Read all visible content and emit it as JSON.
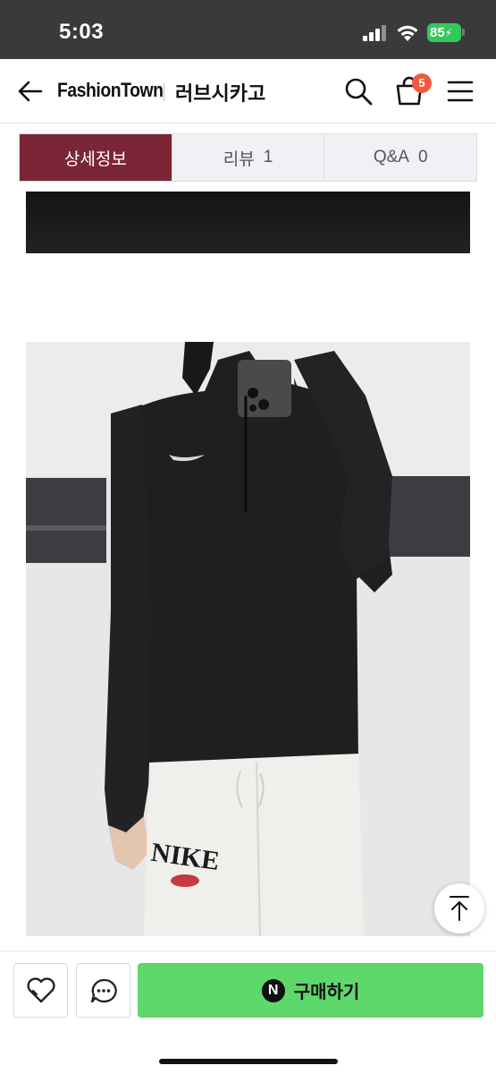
{
  "status_bar": {
    "time": "5:03",
    "battery": "85"
  },
  "header": {
    "brand": "FashionTown",
    "shop_name": "러브시카고",
    "cart_count": "5"
  },
  "tabs": [
    {
      "label": "상세정보",
      "count": "",
      "active": true
    },
    {
      "label": "리뷰",
      "count": "1",
      "active": false
    },
    {
      "label": "Q&A",
      "count": "0",
      "active": false
    }
  ],
  "product_image": {
    "print_text": "NIKE"
  },
  "bottom_bar": {
    "buy_label": "구매하기",
    "pay_badge": "N"
  },
  "colors": {
    "accent_tab": "#7a2636",
    "buy_green": "#5ed76b",
    "badge": "#ef5a3a"
  }
}
